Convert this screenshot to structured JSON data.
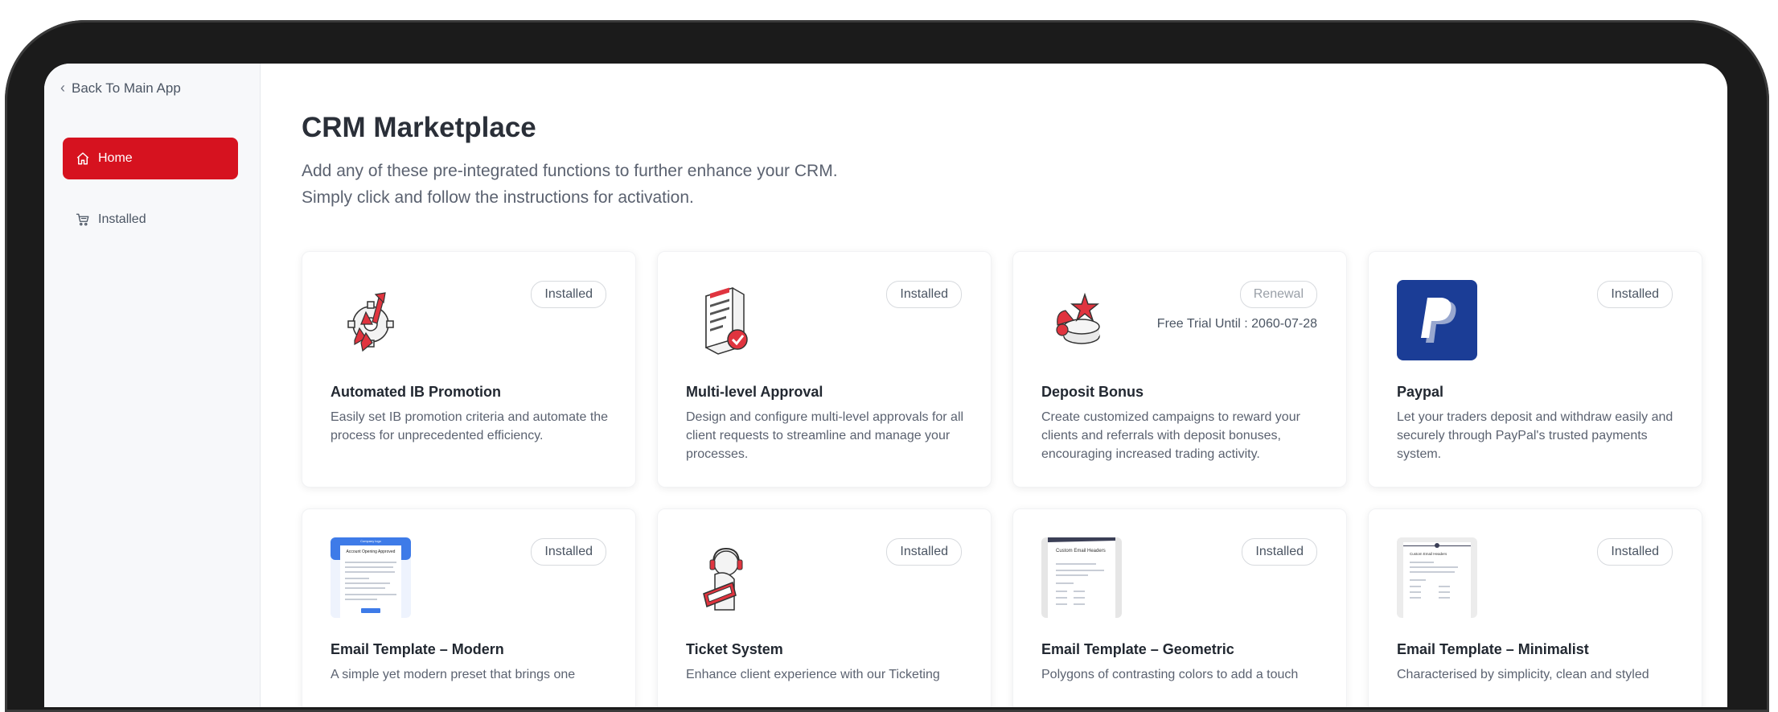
{
  "sidebar": {
    "back_label": "Back To Main App",
    "nav": [
      {
        "label": "Home",
        "active": true,
        "icon": "home-icon"
      },
      {
        "label": "Installed",
        "active": false,
        "icon": "cart-icon"
      }
    ]
  },
  "main": {
    "title": "CRM Marketplace",
    "subtitle_line1": "Add any of these pre-integrated functions to further enhance your CRM.",
    "subtitle_line2": "Simply click and follow the instructions for activation."
  },
  "cards": [
    {
      "title": "Automated IB Promotion",
      "description": "Easily set IB promotion criteria and automate the process for unprecedented efficiency.",
      "badge": "Installed",
      "icon": "ib-promotion-icon"
    },
    {
      "title": "Multi-level Approval",
      "description": "Design and configure multi-level approvals for all client requests to streamline and manage your processes.",
      "badge": "Installed",
      "icon": "approval-document-icon"
    },
    {
      "title": "Deposit Bonus",
      "description": "Create customized campaigns to reward your clients and referrals with deposit bonuses, encouraging increased trading activity.",
      "badge": "Renewal",
      "trial": "Free Trial Until : 2060-07-28",
      "icon": "deposit-bonus-icon"
    },
    {
      "title": "Paypal",
      "description": "Let your traders deposit and withdraw easily and securely through PayPal's trusted payments system.",
      "badge": "Installed",
      "icon": "paypal-logo-icon"
    },
    {
      "title": "Email Template – Modern",
      "description": "A simple yet modern preset that brings one",
      "badge": "Installed",
      "icon": "email-template-modern-thumbnail",
      "thumb_header": "Company logo",
      "thumb_heading": "Account Opening Approved"
    },
    {
      "title": "Ticket System",
      "description": "Enhance client experience with our Ticketing",
      "badge": "Installed",
      "icon": "ticket-system-icon"
    },
    {
      "title": "Email Template – Geometric",
      "description": "Polygons of contrasting colors to add a touch",
      "badge": "Installed",
      "icon": "email-template-geometric-thumbnail",
      "thumb_heading": "Custom Email Headers"
    },
    {
      "title": "Email Template – Minimalist",
      "description": "Characterised by simplicity, clean and styled",
      "badge": "Installed",
      "icon": "email-template-minimalist-thumbnail",
      "thumb_heading": "Custom Email Headers"
    }
  ],
  "colors": {
    "accent": "#d6121f",
    "paypal_bg": "#1b3d96",
    "email_blue": "#3e7be8"
  }
}
